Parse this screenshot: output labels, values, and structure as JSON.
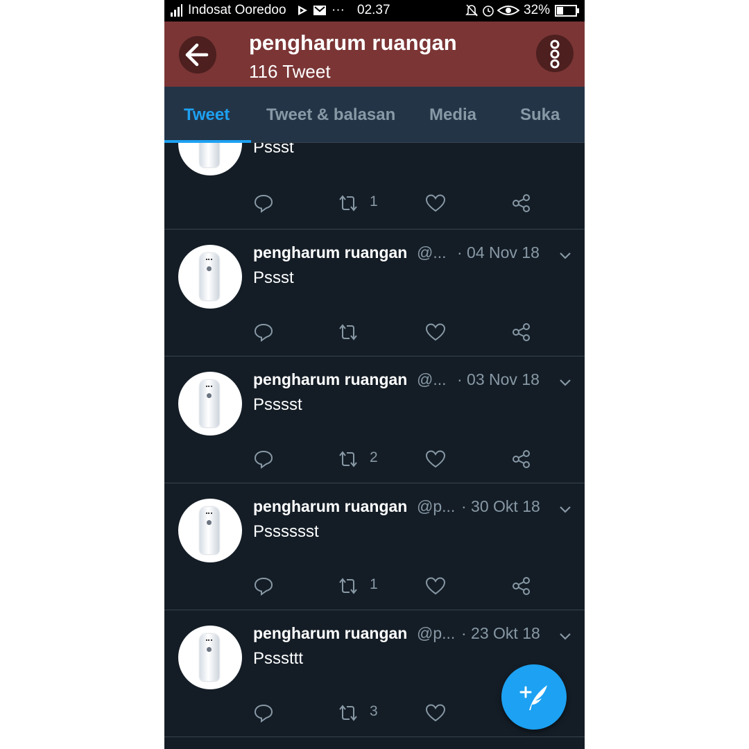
{
  "status_bar": {
    "carrier": "Indosat Ooredoo",
    "dots": "···",
    "time": "02.37",
    "battery": "32%"
  },
  "header": {
    "title": "pengharum ruangan",
    "subtitle": "116 Tweet"
  },
  "tabs": [
    {
      "label": "Tweet",
      "active": true
    },
    {
      "label": "Tweet & balasan",
      "active": false
    },
    {
      "label": "Media",
      "active": false
    },
    {
      "label": "Suka",
      "active": false
    }
  ],
  "tweets": [
    {
      "text": "Pssst",
      "retweets": "1"
    },
    {
      "name": "pengharum ruangan",
      "handle": "@...",
      "date": "· 04 Nov 18",
      "text": "Pssst",
      "retweets": ""
    },
    {
      "name": "pengharum ruangan",
      "handle": "@...",
      "date": "· 03 Nov 18",
      "text": "Psssst",
      "retweets": "2"
    },
    {
      "name": "pengharum ruangan",
      "handle": "@p...",
      "date": "· 30 Okt 18",
      "text": "Psssssst",
      "retweets": "1"
    },
    {
      "name": "pengharum ruangan",
      "handle": "@p...",
      "date": "· 23 Okt 18",
      "text": "Psssttt",
      "retweets": "3"
    }
  ],
  "icons": {
    "back": "arrow-left-icon",
    "menu": "more-vertical-icon",
    "reply": "reply-icon",
    "retweet": "retweet-icon",
    "like": "heart-icon",
    "share": "share-icon",
    "compose": "compose-tweet-icon"
  },
  "colors": {
    "header_bg": "#7b3535",
    "accent": "#1da1f2",
    "timeline_bg": "#141d26",
    "tabbar_bg": "#243447"
  }
}
